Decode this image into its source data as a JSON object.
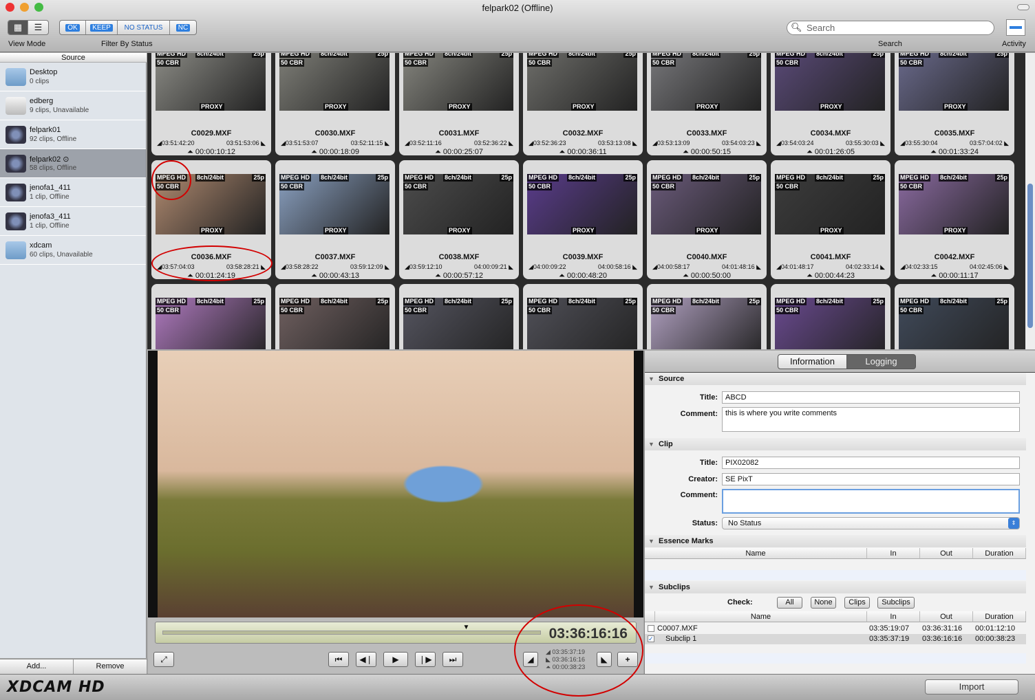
{
  "window": {
    "title": "felpark02 (Offline)"
  },
  "toolbar": {
    "view_mode_label": "View Mode",
    "filter_label": "Filter By Status",
    "filters": [
      "OK",
      "KEEP",
      "NO STATUS",
      "NC"
    ],
    "search_placeholder": "Search",
    "search_label": "Search",
    "activity_label": "Activity"
  },
  "sidebar": {
    "header": "Source",
    "items": [
      {
        "name": "Desktop",
        "sub": "0 clips",
        "icon": "folder-icon"
      },
      {
        "name": "edberg",
        "sub": "9 clips, Unavailable",
        "icon": "sxs-card-icon"
      },
      {
        "name": "felpark01",
        "sub": "92 clips, Offline",
        "icon": "disc-icon"
      },
      {
        "name": "felpark02 ⊙",
        "sub": "58 clips, Offline",
        "icon": "disc-icon",
        "selected": true
      },
      {
        "name": "jenofa1_411",
        "sub": "1 clip, Offline",
        "icon": "disc-icon"
      },
      {
        "name": "jenofa3_411",
        "sub": "1 clip, Offline",
        "icon": "disc-icon"
      },
      {
        "name": "xdcam",
        "sub": "60 clips, Unavailable",
        "icon": "folder-icon"
      }
    ],
    "add_label": "Add...",
    "remove_label": "Remove"
  },
  "badges": {
    "codec": "MPEG HD",
    "audio": "8ch/24bit",
    "rate": "25p",
    "bitrate": "50 CBR",
    "proxy": "PROXY"
  },
  "clips": [
    {
      "name": "C0029.MXF",
      "in": "03:51:42:20",
      "out": "03:51:53:06",
      "dur": "00:00:10:12",
      "color": "#8c8c86"
    },
    {
      "name": "C0030.MXF",
      "in": "03:51:53:07",
      "out": "03:52:11:15",
      "dur": "00:00:18:09",
      "color": "#7f7f78"
    },
    {
      "name": "C0031.MXF",
      "in": "03:52:11:16",
      "out": "03:52:36:22",
      "dur": "00:00:25:07",
      "color": "#85857e"
    },
    {
      "name": "C0032.MXF",
      "in": "03:52:36:23",
      "out": "03:53:13:08",
      "dur": "00:00:36:11",
      "color": "#6e6e6a"
    },
    {
      "name": "C0033.MXF",
      "in": "03:53:13:09",
      "out": "03:54:03:23",
      "dur": "00:00:50:15",
      "color": "#77777a"
    },
    {
      "name": "C0034.MXF",
      "in": "03:54:03:24",
      "out": "03:55:30:03",
      "dur": "00:01:26:05",
      "color": "#5a4a78"
    },
    {
      "name": "C0035.MXF",
      "in": "03:55:30:04",
      "out": "03:57:04:02",
      "dur": "00:01:33:24",
      "color": "#6a6a8c"
    },
    {
      "name": "C0036.MXF",
      "in": "03:57:04:03",
      "out": "03:58:28:21",
      "dur": "00:01:24:19",
      "color": "#b08a70"
    },
    {
      "name": "C0037.MXF",
      "in": "03:58:28:22",
      "out": "03:59:12:09",
      "dur": "00:00:43:13",
      "color": "#8aa0c0"
    },
    {
      "name": "C0038.MXF",
      "in": "03:59:12:10",
      "out": "04:00:09:21",
      "dur": "00:00:57:12",
      "color": "#4c4c4c"
    },
    {
      "name": "C0039.MXF",
      "in": "04:00:09:22",
      "out": "04:00:58:16",
      "dur": "00:00:48:20",
      "color": "#5a3c8c"
    },
    {
      "name": "C0040.MXF",
      "in": "04:00:58:17",
      "out": "04:01:48:16",
      "dur": "00:00:50:00",
      "color": "#6a5a7a"
    },
    {
      "name": "C0041.MXF",
      "in": "04:01:48:17",
      "out": "04:02:33:14",
      "dur": "00:00:44:23",
      "color": "#3c3c3c"
    },
    {
      "name": "C0042.MXF",
      "in": "04:02:33:15",
      "out": "04:02:45:06",
      "dur": "00:00:11:17",
      "color": "#8a6aa0"
    },
    {
      "color": "#b07ac0"
    },
    {
      "color": "#706060"
    },
    {
      "color": "#555560"
    },
    {
      "color": "#505058"
    },
    {
      "color": "#b0a0c0"
    },
    {
      "color": "#6a4a90"
    },
    {
      "color": "#404a5a"
    }
  ],
  "player": {
    "timecode": "03:36:16:16",
    "in": "03:35:37:19",
    "out": "03:36:16:16",
    "duration": "00:00:38:23",
    "progress": 0.62
  },
  "inspector": {
    "tabs": [
      "Information",
      "Logging"
    ],
    "active_tab": "Logging",
    "source": {
      "header": "Source",
      "title_label": "Title:",
      "title": "ABCD",
      "comment_label": "Comment:",
      "comment": "this is where you write comments"
    },
    "clip": {
      "header": "Clip",
      "title_label": "Title:",
      "title": "PIX02082",
      "creator_label": "Creator:",
      "creator": "SE  PixT",
      "comment_label": "Comment:",
      "comment": "",
      "status_label": "Status:",
      "status": "No Status"
    },
    "essence": {
      "header": "Essence Marks",
      "columns": [
        "Name",
        "In",
        "Out",
        "Duration"
      ]
    },
    "subclips": {
      "header": "Subclips",
      "check_label": "Check:",
      "buttons": [
        "All",
        "None",
        "Clips",
        "Subclips"
      ],
      "columns": [
        "Name",
        "In",
        "Out",
        "Duration"
      ],
      "rows": [
        {
          "name": "C0007.MXF",
          "in": "03:35:19:07",
          "out": "03:36:31:16",
          "dur": "00:01:12:10",
          "checked": false
        },
        {
          "name": "Subclip 1",
          "in": "03:35:37:19",
          "out": "03:36:16:16",
          "dur": "00:00:38:23",
          "checked": true
        }
      ]
    }
  },
  "footer": {
    "logo": "XDCAM HD",
    "import_label": "Import"
  },
  "colors": {
    "accent": "#2e7fdf",
    "annotation": "#d20000"
  }
}
